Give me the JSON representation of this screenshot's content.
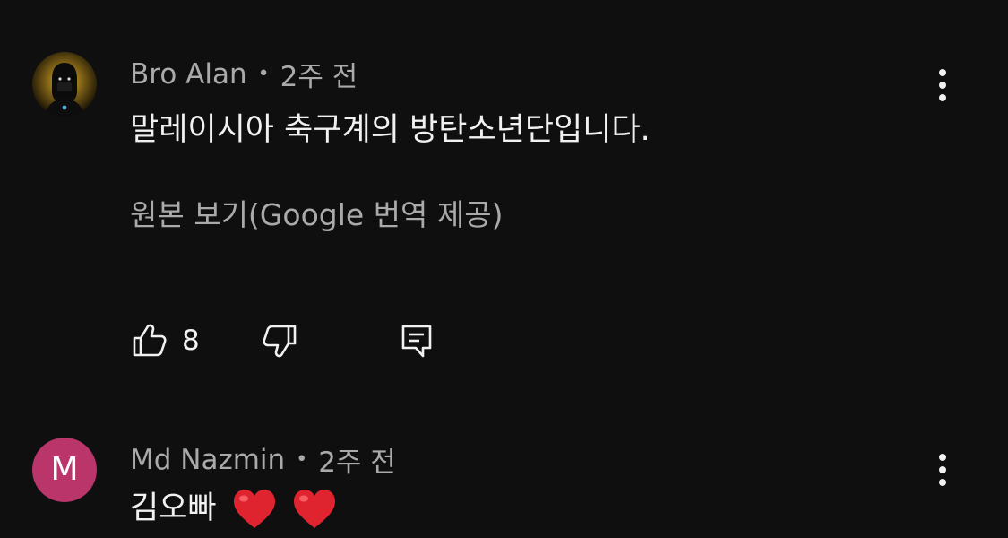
{
  "comments": [
    {
      "author": "Bro Alan",
      "separator": "•",
      "time": "2주 전",
      "text": "말레이시아 축구계의 방탄소년단입니다.",
      "translate_link": "원본 보기(Google 번역 제공)",
      "likes": "8",
      "avatar_icon": "profile-photo"
    },
    {
      "author": "Md Nazmin",
      "separator": "•",
      "time": "2주 전",
      "text": "김오빠",
      "avatar_letter": "M",
      "avatar_color": "#b9356a",
      "emoji": [
        "heart-emoji",
        "heart-emoji"
      ]
    }
  ],
  "colors": {
    "background": "#0f0f0f",
    "primary_text": "#f1f1f1",
    "secondary_text": "#aaaaaa",
    "heart": "#e0242f"
  }
}
